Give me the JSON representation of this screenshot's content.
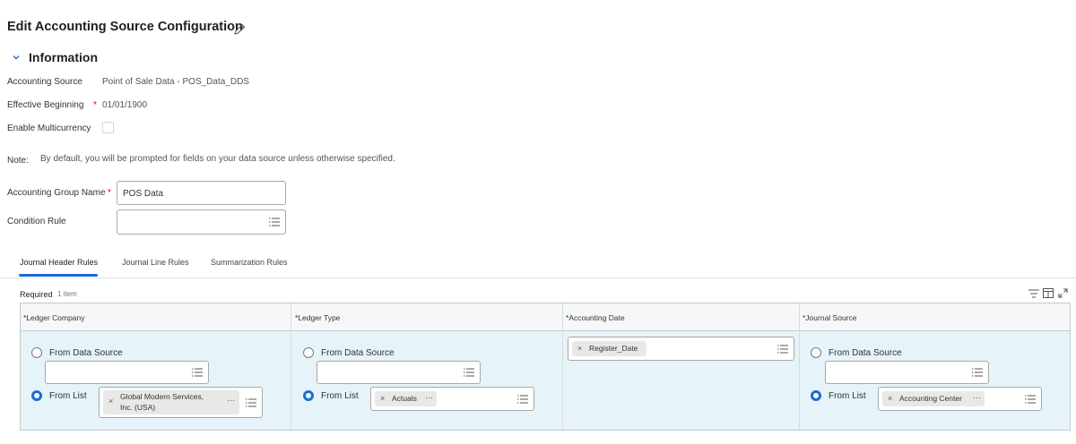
{
  "page": {
    "title": "Edit Accounting Source Configuration"
  },
  "information": {
    "section_title": "Information",
    "accounting_source_label": "Accounting Source",
    "accounting_source_value": "Point of Sale Data - POS_Data_DDS",
    "effective_beginning_label": "Effective Beginning",
    "effective_beginning_value": "01/01/1900",
    "required_marker": "*",
    "enable_multicurrency_label": "Enable Multicurrency",
    "note_label": "Note:",
    "note_text": "By default, you will be prompted for fields on your data source unless otherwise specified.",
    "accounting_group_name_label": "Accounting Group Name",
    "accounting_group_name_value": "POS Data",
    "condition_rule_label": "Condition Rule",
    "condition_rule_value": ""
  },
  "tabs": [
    {
      "label": "Journal Header Rules",
      "active": true
    },
    {
      "label": "Journal Line Rules",
      "active": false
    },
    {
      "label": "Summarization Rules",
      "active": false
    }
  ],
  "grid": {
    "title": "Required",
    "count": "1 item",
    "columns": [
      "*Ledger Company",
      "*Ledger Type",
      "*Accounting Date",
      "*Journal Source"
    ],
    "row": {
      "ledger_company": {
        "option_data_source": "From Data Source",
        "option_list": "From List",
        "selected": "From List",
        "chip": "Global Modern Services, Inc. (USA)",
        "chip_line1": "Global Modern Services,",
        "chip_line2": "Inc. (USA)"
      },
      "ledger_type": {
        "option_data_source": "From Data Source",
        "option_list": "From List",
        "selected": "From List",
        "chip": "Actuals"
      },
      "accounting_date": {
        "chip": "Register_Date"
      },
      "journal_source": {
        "option_data_source": "From Data Source",
        "option_list": "From List",
        "selected": "From List",
        "chip": "Accounting Center"
      }
    }
  },
  "colors": {
    "accent": "#1a6cd6",
    "required": "#d0021b",
    "row_bg": "#e6f3f8"
  },
  "icons": [
    "pencil-icon",
    "chevron-down-icon",
    "list-icon",
    "filter-icon",
    "columns-icon",
    "expand-icon",
    "remove-icon",
    "ellipsis-icon"
  ]
}
